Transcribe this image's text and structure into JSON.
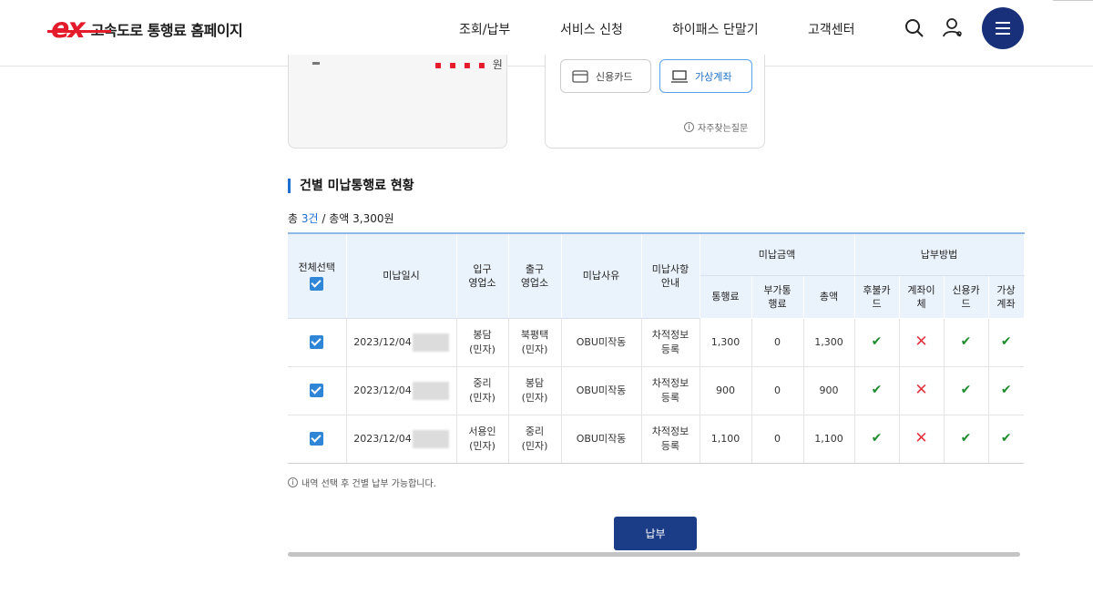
{
  "header": {
    "logo_mark": "ex",
    "site_title": "고속도로 통행료 홈페이지",
    "nav": [
      "조회/납부",
      "서비스 신청",
      "하이패스 단말기",
      "고객센터"
    ]
  },
  "top_boxes": {
    "left_amount_fragment": "원",
    "pay_card_label": "신용카드",
    "pay_virtual_label": "가상계좌",
    "faq_label": "자주찾는질문"
  },
  "section": {
    "title": "건별 미납통행료 현황",
    "summary_prefix": "총 ",
    "summary_count": "3건",
    "summary_suffix": " / 총액 3,300원"
  },
  "table": {
    "headers": {
      "select_all": "전체선택",
      "date": "미납일시",
      "entry": "입구\n영업소",
      "exit": "출구\n영업소",
      "reason": "미납사유",
      "guide": "미납사항\n안내",
      "amount_group": "미납금액",
      "toll": "통행료",
      "surcharge": "부가통\n행료",
      "total": "총액",
      "method_group": "납부방법",
      "postpaid": "후불카\n드",
      "transfer": "계좌이\n체",
      "credit": "신용카\n드",
      "virtual": "가상\n계좌"
    },
    "rows": [
      {
        "date": "2023/12/04",
        "entry": "봉담\n(민자)",
        "exit": "북평택\n(민자)",
        "reason": "OBU미작동",
        "guide": "차적정보\n등록",
        "toll": "1,300",
        "surcharge": "0",
        "total": "1,300"
      },
      {
        "date": "2023/12/04",
        "entry": "중리\n(민자)",
        "exit": "봉담\n(민자)",
        "reason": "OBU미작동",
        "guide": "차적정보\n등록",
        "toll": "900",
        "surcharge": "0",
        "total": "900"
      },
      {
        "date": "2023/12/04",
        "entry": "서용인\n(민자)",
        "exit": "중리\n(민자)",
        "reason": "OBU미작동",
        "guide": "차적정보\n등록",
        "toll": "1,100",
        "surcharge": "0",
        "total": "1,100"
      }
    ]
  },
  "notice": "내역 선택 후 건별 납부 가능합니다.",
  "submit_label": "납부",
  "icons": {
    "available": "check-icon",
    "unavailable": "x-icon"
  },
  "colors": {
    "brand_red": "#e31b2b",
    "navy": "#1b3d87",
    "accent_blue": "#1e6fd0",
    "ok_green": "#1e8c2e",
    "no_red": "#e3343f"
  }
}
